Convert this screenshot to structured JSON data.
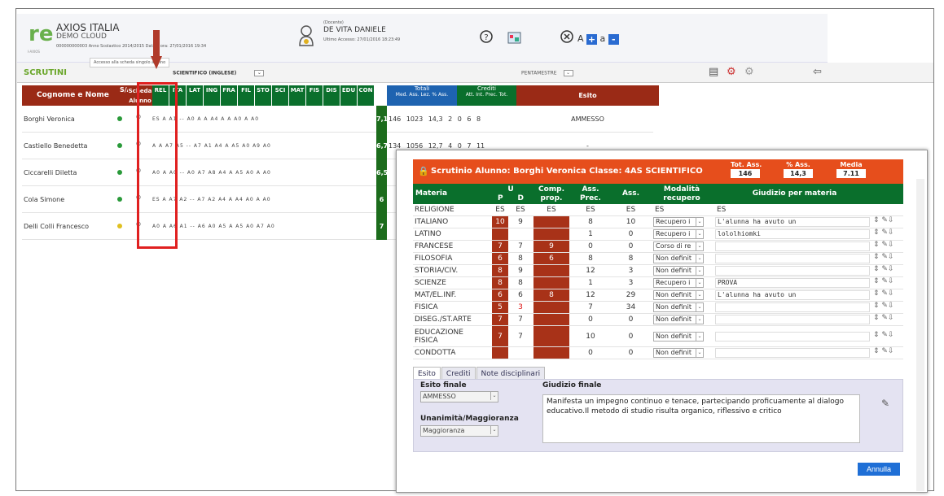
{
  "app": {
    "name": "AXIOS ITALIA",
    "sub": "DEMO CLOUD",
    "info": "000000000003 Anno Scolastico 2014/2015 Data e ora: 27/01/2016 19:34",
    "logo_caption": "I-AXIOS"
  },
  "user": {
    "role": "(Docente)",
    "name": "DE VITA DANIELE",
    "last_access": "Ultimo Accesso: 27/01/2016 18:23:49"
  },
  "toolbar": {
    "font_small": "A",
    "font_a": "a",
    "plus": "+",
    "minus": "-"
  },
  "subbar": {
    "section": "SCRUTINI",
    "tooltip": "Accesso alla scheda singolo alunno",
    "class_select": "SCIENTIFICO (INGLESE)",
    "period": "PENTAMESTRE"
  },
  "grid": {
    "name_header": "Cognome e Nome",
    "sa_header": "S/A",
    "scheda_header": "Scheda Alunno",
    "subjects": [
      "REL",
      "ITA",
      "LAT",
      "ING",
      "FRA",
      "FIL",
      "STO",
      "SCI",
      "MAT",
      "FIS",
      "DIS",
      "EDU",
      "CON"
    ],
    "totali": "Totali",
    "totali_cols": "Med. Ass. Lez. % Ass.",
    "crediti": "Crediti",
    "crediti_cols": "Att. Int. Prec. Tot.",
    "esito": "Esito",
    "rows": [
      {
        "name": "Borghi Veronica",
        "votes": "ES  A  A1  --  A0  A  A  A4  A  A  A0  A  A0",
        "med": "7,1",
        "totals": "146 1023 14,3   2  0  6  8",
        "esito": "AMMESSO"
      },
      {
        "name": "Castiello Benedetta",
        "votes": "A  A  A7  A5  --  A7  A1  A4  A  A5  A0  A9  A0",
        "med": "6,7",
        "totals": "134 1056 12,7   4  0  7  11",
        "esito": "-"
      },
      {
        "name": "Ciccarelli Diletta",
        "votes": "A0  A  A0  --  A0  A7  A8  A4  A  A5  A0  A  A0",
        "med": "6,5",
        "totals": "",
        "esito": ""
      },
      {
        "name": "Cola Simone",
        "votes": "ES  A  A7  A2  --  A7  A2  A4  A  A4  A0  A  A0",
        "med": "6",
        "totals": "",
        "esito": ""
      },
      {
        "name": "Delli Colli Francesco",
        "votes": "A0  A  A6  A1  --  A6  A0  A5  A  A5  A0  A7  A0",
        "med": "7",
        "totals": "",
        "esito": ""
      }
    ]
  },
  "modal": {
    "title": "Scrutinio Alunno: Borghi Veronica Classe: 4AS SCIENTIFICO",
    "tot_ass_label": "Tot. Ass.",
    "tot_ass": "146",
    "pct_ass_label": "% Ass.",
    "pct_ass": "14,3",
    "media_label": "Media",
    "media": "7.11",
    "headers": {
      "materia": "Materia",
      "u": "U",
      "p": "P",
      "d": "D",
      "comp": "Comp. prop.",
      "ass_prec": "Ass. Prec.",
      "ass": "Ass.",
      "modalita": "Modalità recupero",
      "giudizio": "Giudizio per materia"
    },
    "rows": [
      {
        "materia": "RELIGIONE",
        "p": "ES",
        "d": "ES",
        "comp": "ES",
        "ass_prec": "ES",
        "ass": "ES",
        "mod": "ES",
        "giud": "ES",
        "plain": true
      },
      {
        "materia": "ITALIANO",
        "p": "10",
        "d": "9",
        "comp": "",
        "ass_prec": "8",
        "ass": "10",
        "mod": "Recupero i",
        "giud": "L'alunna ha avuto un"
      },
      {
        "materia": "LATINO",
        "p": "",
        "d": "",
        "comp": "",
        "ass_prec": "1",
        "ass": "0",
        "mod": "Recupero i",
        "giud": "lololhiomki"
      },
      {
        "materia": "FRANCESE",
        "p": "7",
        "d": "7",
        "comp": "9",
        "ass_prec": "0",
        "ass": "0",
        "mod": "Corso di re",
        "giud": ""
      },
      {
        "materia": "FILOSOFIA",
        "p": "6",
        "d": "8",
        "comp": "6",
        "ass_prec": "8",
        "ass": "8",
        "mod": "Non definit",
        "giud": ""
      },
      {
        "materia": "STORIA/CIV.",
        "p": "8",
        "d": "9",
        "comp": "",
        "ass_prec": "12",
        "ass": "3",
        "mod": "Non definit",
        "giud": ""
      },
      {
        "materia": "SCIENZE",
        "p": "8",
        "d": "8",
        "comp": "",
        "ass_prec": "1",
        "ass": "3",
        "mod": "Recupero i",
        "giud": "PROVA"
      },
      {
        "materia": "MAT/EL.INF.",
        "p": "6",
        "d": "6",
        "comp": "8",
        "ass_prec": "12",
        "ass": "29",
        "mod": "Non definit",
        "giud": "L'alunna ha avuto un"
      },
      {
        "materia": "FISICA",
        "p": "5",
        "d": "3",
        "comp": "",
        "ass_prec": "7",
        "ass": "34",
        "mod": "Non definit",
        "giud": "",
        "d_red": true
      },
      {
        "materia": "DISEG./ST.ARTE",
        "p": "7",
        "d": "7",
        "comp": "",
        "ass_prec": "0",
        "ass": "0",
        "mod": "Non definit",
        "giud": ""
      },
      {
        "materia": "EDUCAZIONE FISICA",
        "p": "7",
        "d": "7",
        "comp": "",
        "ass_prec": "10",
        "ass": "0",
        "mod": "Non definit",
        "giud": "",
        "tall": true
      },
      {
        "materia": "CONDOTTA",
        "p": "",
        "d": "",
        "comp": "",
        "ass_prec": "0",
        "ass": "0",
        "mod": "Non definit",
        "giud": ""
      }
    ],
    "tabs": [
      "Esito",
      "Crediti",
      "Note disciplinari"
    ],
    "esito_finale_label": "Esito finale",
    "esito_finale": "AMMESSO",
    "unanimita_label": "Unanimità/Maggioranza",
    "unanimita": "Maggioranza",
    "giudizio_finale_label": "Giudizio finale",
    "giudizio_finale": "Manifesta un impegno continuo e tenace, partecipando proficuamente al dialogo educativo.Il metodo di studio risulta organico, riflessivo e critico",
    "annulla": "Annulla"
  }
}
